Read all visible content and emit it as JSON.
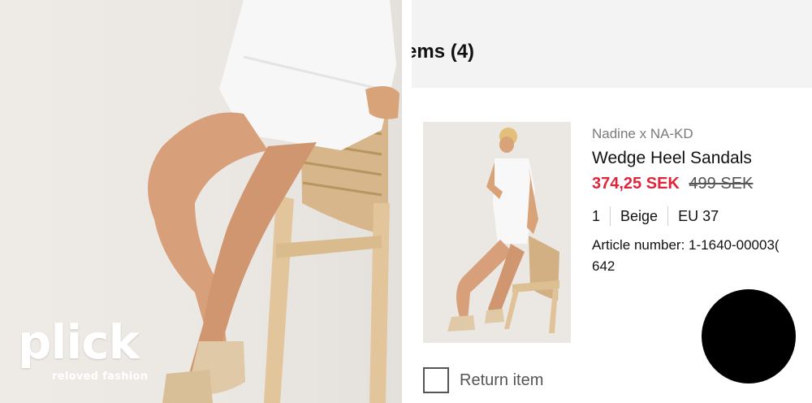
{
  "logo": {
    "word": "plick",
    "tagline": "reloved fashion"
  },
  "cart": {
    "title": "ems (4)",
    "item": {
      "brand": "Nadine x NA-KD",
      "name": "Wedge Heel Sandals",
      "price_sale": "374,25 SEK",
      "price_original": "499 SEK",
      "quantity": "1",
      "color": "Beige",
      "size": "EU 37",
      "article_line1": "Article number: 1-1640-00003(",
      "article_line2": "642",
      "return_label": "Return item"
    }
  },
  "colors": {
    "sale_price": "#e0243c",
    "header_bg": "#f3f3f3"
  },
  "icons": [
    "checkbox-icon"
  ]
}
